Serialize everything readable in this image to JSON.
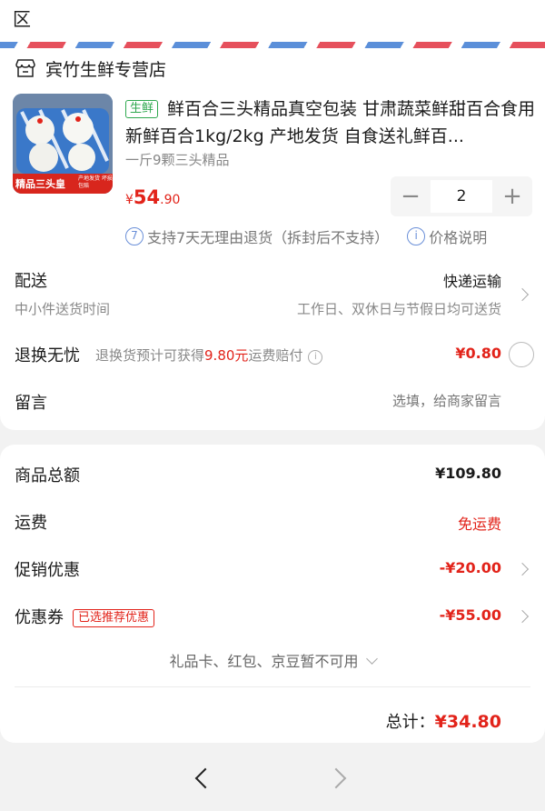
{
  "header": {
    "partial_text": "区"
  },
  "shop": {
    "name": "宾竹生鲜专营店",
    "icon": "store-icon"
  },
  "product": {
    "tag": "生鲜",
    "title": "鲜百合三头精品真空包装 甘肃蔬菜鲜甜百合食用新鲜百合1kg/2kg 产地发货 自食送礼鲜百...",
    "spec": "一斤9颗三头精品",
    "price_currency": "¥",
    "price_int": "54",
    "price_dec": ".90",
    "quantity": "2",
    "image_text": "精品三头皇",
    "image_subtext": "产地发货 坏损包赔",
    "promise_icon_1": "7",
    "promise_text_1": "支持7天无理由退货（拆封后不支持）",
    "promise_icon_2": "i",
    "promise_text_2": "价格说明"
  },
  "delivery": {
    "label": "配送",
    "sub": "中小件送货时间",
    "value": "快递运输",
    "value_sub": "工作日、双休日与节假日均可送货"
  },
  "return_insurance": {
    "label": "退换无忧",
    "desc_pre": "退换货预计可获得",
    "desc_amount": "9.80元",
    "desc_post": "运费赔付",
    "price": "¥0.80"
  },
  "note": {
    "label": "留言",
    "placeholder": "选填，给商家留言"
  },
  "summary": {
    "goods_label": "商品总额",
    "goods_value": "¥109.80",
    "shipping_label": "运费",
    "shipping_value": "免运费",
    "promo_label": "促销优惠",
    "promo_value": "-¥20.00",
    "coupon_label": "优惠券",
    "coupon_tag": "已选推荐优惠",
    "coupon_value": "-¥55.00",
    "unavailable": "礼品卡、红包、京豆暂不可用",
    "total_label": "总计：",
    "total_value": "¥34.80"
  },
  "colors": {
    "accent_red": "#e2231a",
    "fresh_green": "#2fa84f",
    "info_blue": "#6a8fd8"
  }
}
